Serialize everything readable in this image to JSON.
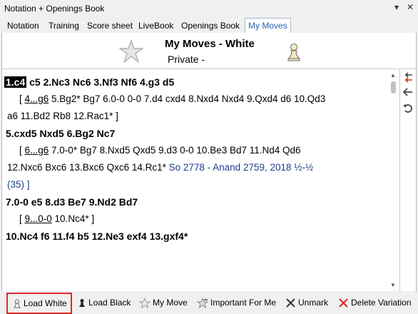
{
  "window": {
    "title": "Notation + Openings Book",
    "pin_glyph": "▾",
    "close_glyph": "✕"
  },
  "tabs": [
    "Notation",
    "Training",
    "Score sheet",
    "LiveBook",
    "Openings Book",
    "My Moves"
  ],
  "active_tab": "My Moves",
  "header": {
    "title": "My Moves - White",
    "subtitle": "Private -"
  },
  "notation": {
    "l1_first": "1.c4",
    "l1_rest": "c5  2.Nc3  Nc6  3.Nf3  Nf6  4.g3  d5",
    "l2_open": "[ ",
    "l2_link": "4...g6",
    "l2_rest": " 5.Bg2*  Bg7  6.0-0  0-0  7.d4  cxd4  8.Nxd4  Nxd4  9.Qxd4  d6  10.Qd3",
    "l3": "a6  11.Bd2  Rb8  12.Rac1* ]",
    "l4": "5.cxd5  Nxd5  6.Bg2  Nc7",
    "l5_open": "[ ",
    "l5_link": "6...g6",
    "l5_rest": " 7.0-0*  Bg7  8.Nxd5  Qxd5  9.d3  0-0  10.Be3  Bd7  11.Nd4  Qd6",
    "l6_moves": "12.Nxc6  Bxc6  13.Bxc6  Qxc6  14.Rc1*",
    "l6_game": " So 2778 - Anand 2759, 2018 ½-½",
    "l7": "(35) ]",
    "l8": "7.0-0  e5  8.d3  Be7  9.Nd2  Bd7",
    "l9_open": "[ ",
    "l9_link": "9...0-0",
    "l9_rest": " 10.Nc4* ]",
    "l10": "10.Nc4  f6  11.f4  b5  12.Ne3  exf4  13.gxf4*"
  },
  "buttons": {
    "load_white": "Load White",
    "load_black": "Load Black",
    "my_move": "My Move",
    "important": "Important For Me",
    "unmark": "Unmark",
    "delete_variation": "Delete Variation"
  },
  "colors": {
    "accent_red": "#e0282b",
    "tab_active": "#2a62b5",
    "game_ref": "#1f3d8c"
  }
}
